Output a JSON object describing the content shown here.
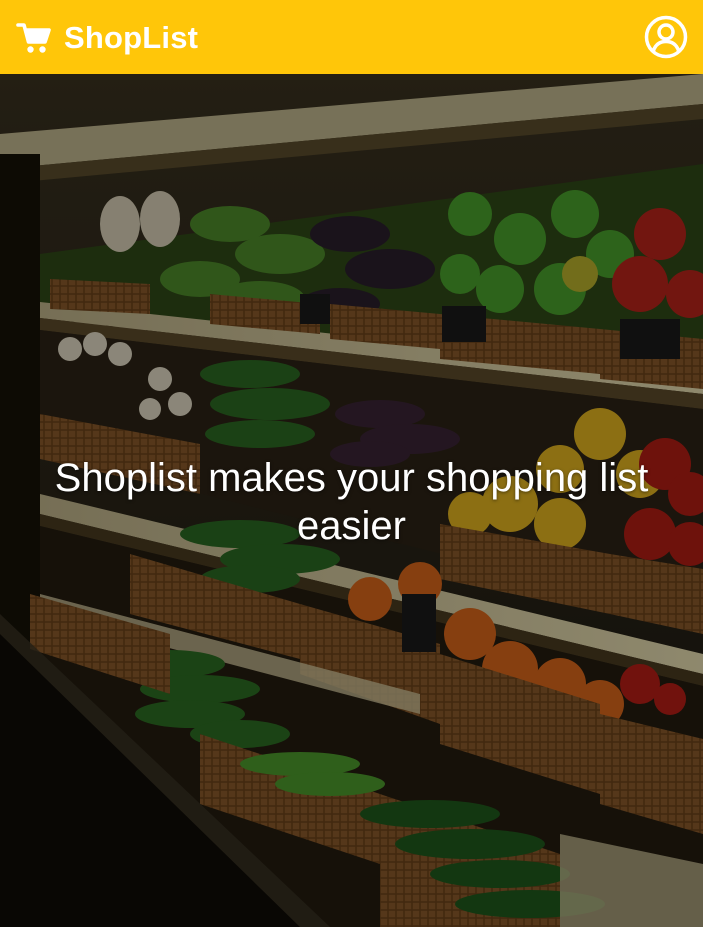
{
  "app": {
    "title": "ShopList",
    "brand_color": "#ffc609",
    "header_text_color": "#ffffff"
  },
  "header": {
    "logo_icon": "cart-icon",
    "profile_icon": "user-circle-icon"
  },
  "hero": {
    "tagline": "Shoplist makes your shopping list easier",
    "background": "supermarket produce shelves photo"
  }
}
